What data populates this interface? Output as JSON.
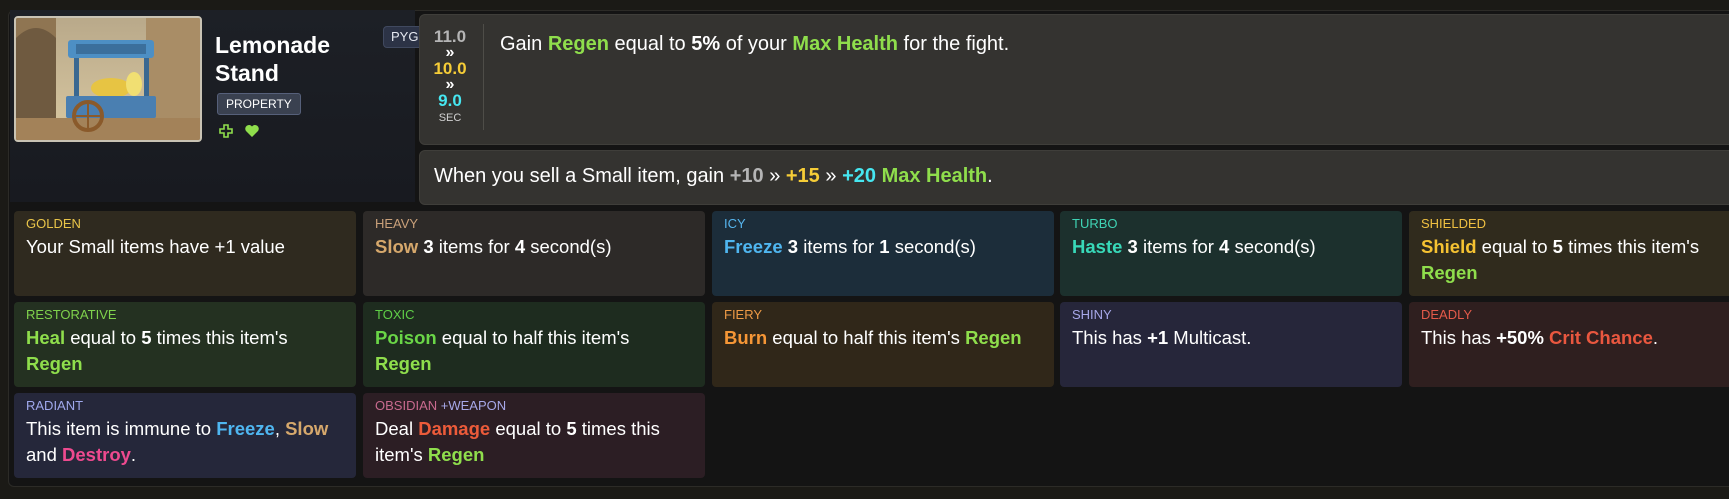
{
  "item": {
    "name": "Lemonade Stand",
    "set_badge": "PYG",
    "tag": "PROPERTY",
    "header_icons": [
      "plus-icon",
      "heart-icon"
    ]
  },
  "cooldown": {
    "values": [
      "11.0",
      "10.0",
      "9.0"
    ],
    "separator": "»",
    "unit": "SEC"
  },
  "ability1": {
    "t1": "Gain ",
    "regen": "Regen",
    "t2": " equal to ",
    "pct": "5%",
    "t3": " of your ",
    "maxhp": "Max Health",
    "t4": " for the fight."
  },
  "ability2": {
    "t1": "When you sell a Small item, gain ",
    "v1": "+10",
    "sep": "»",
    "v2": "+15",
    "v3": "+20",
    "maxhp": "Max Health",
    "end": "."
  },
  "enchantments": {
    "golden": {
      "title": "GOLDEN",
      "text": "Your Small items have +1 value"
    },
    "heavy": {
      "title": "HEAVY",
      "kw": "Slow",
      "n1": "3",
      "t1": " items for ",
      "n2": "4",
      "t2": " second(s)"
    },
    "icy": {
      "title": "ICY",
      "kw": "Freeze",
      "n1": "3",
      "t1": " items for ",
      "n2": "1",
      "t2": " second(s)"
    },
    "turbo": {
      "title": "TURBO",
      "kw": "Haste",
      "n1": "3",
      "t1": " items for ",
      "n2": "4",
      "t2": " second(s)"
    },
    "shielded": {
      "title": "SHIELDED",
      "kw": "Shield",
      "t1": " equal to ",
      "n1": "5",
      "t2": " times this item's",
      "regen": "Regen"
    },
    "restorative": {
      "title": "RESTORATIVE",
      "kw": "Heal",
      "t1": " equal to ",
      "n1": "5",
      "t2": " times this item's",
      "regen": "Regen"
    },
    "toxic": {
      "title": "TOXIC",
      "kw": "Poison",
      "t1": " equal to half this item's",
      "regen": "Regen"
    },
    "fiery": {
      "title": "FIERY",
      "kw": "Burn",
      "t1": " equal to half this item's ",
      "regen": "Regen"
    },
    "shiny": {
      "title": "SHINY",
      "t1": "This has ",
      "n1": "+1",
      "t2": " Multicast."
    },
    "deadly": {
      "title": "DEADLY",
      "t1": "This has ",
      "n1": "+50%",
      "kw": "Crit Chance",
      "end": "."
    },
    "radiant": {
      "title": "RADIANT",
      "t1": "This item is immune to ",
      "kw1": "Freeze",
      "sep": ", ",
      "kw2": "Slow",
      "t2": "and ",
      "kw3": "Destroy",
      "end": "."
    },
    "obsidian": {
      "title": "OBSIDIAN",
      "extra": "+WEAPON",
      "t1": "Deal ",
      "kw": "Damage",
      "t2": " equal to ",
      "n1": "5",
      "t3": " times this",
      "t4": "item's ",
      "regen": "Regen"
    }
  },
  "colors": {
    "regen": "#8fde4c",
    "gold": "#f6cd37",
    "cyan": "#46e6f0",
    "panel": "#343330"
  }
}
